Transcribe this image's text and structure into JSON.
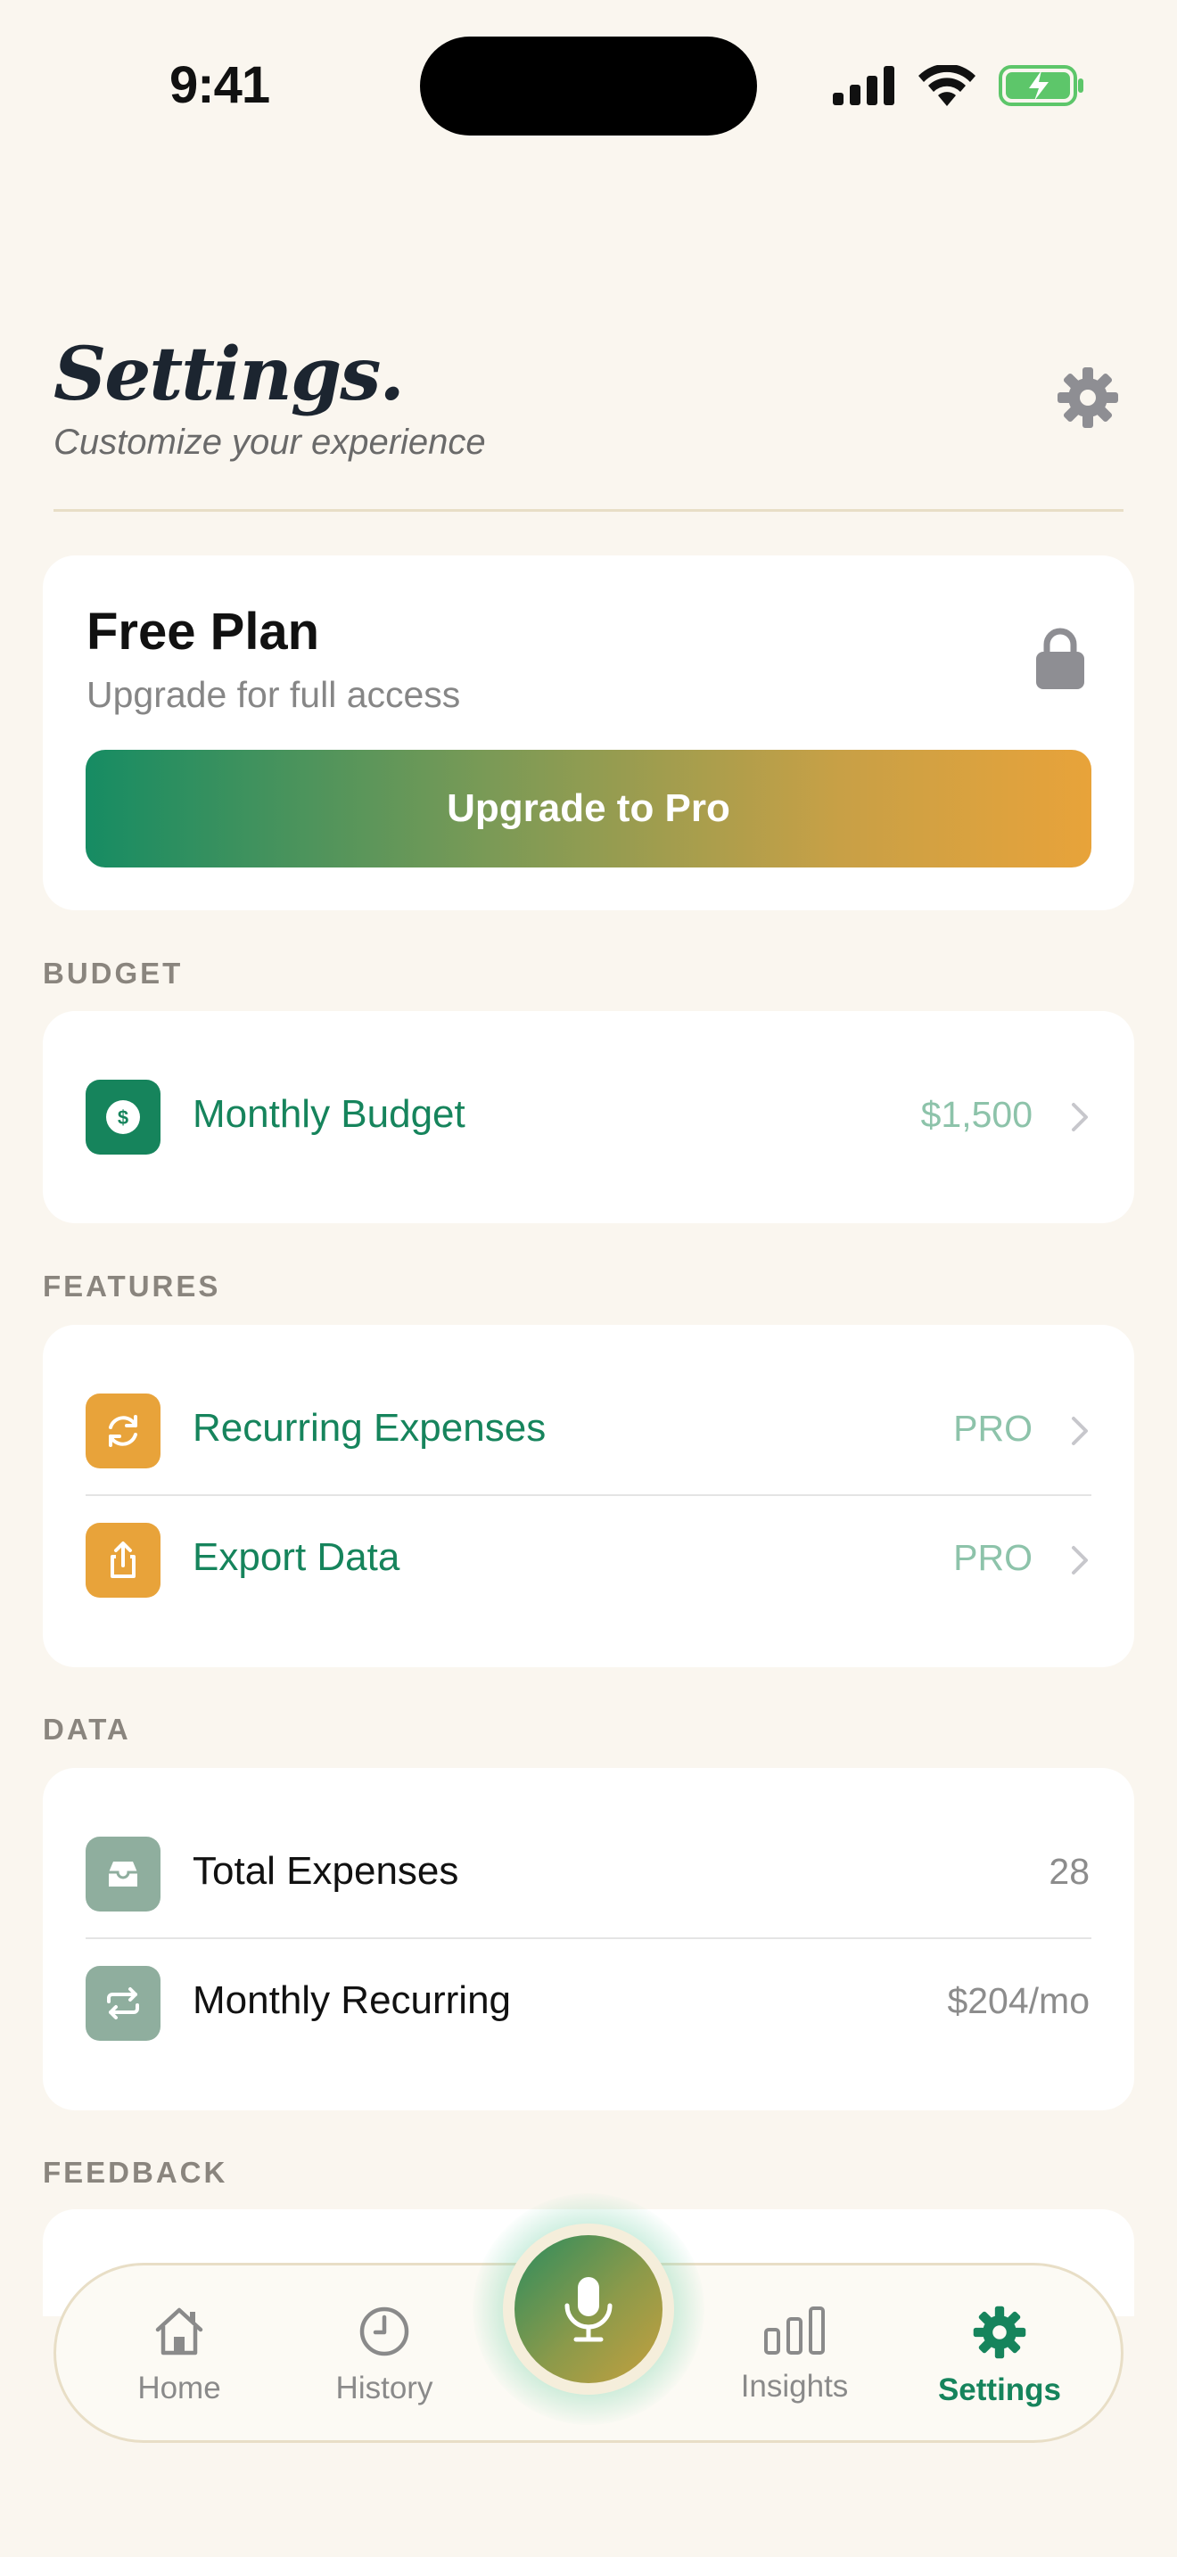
{
  "status": {
    "time": "9:41"
  },
  "header": {
    "title": "Settings.",
    "subtitle": "Customize your experience"
  },
  "plan": {
    "title": "Free Plan",
    "subtitle": "Upgrade for full access",
    "button_label": "Upgrade to Pro"
  },
  "sections": {
    "budget": {
      "label": "BUDGET",
      "items": [
        {
          "label": "Monthly Budget",
          "value": "$1,500",
          "icon": "dollar-icon"
        }
      ]
    },
    "features": {
      "label": "FEATURES",
      "items": [
        {
          "label": "Recurring Expenses",
          "value": "PRO",
          "icon": "recurring-icon"
        },
        {
          "label": "Export Data",
          "value": "PRO",
          "icon": "share-icon"
        }
      ]
    },
    "data": {
      "label": "DATA",
      "items": [
        {
          "label": "Total Expenses",
          "value": "28",
          "icon": "tray-icon"
        },
        {
          "label": "Monthly Recurring",
          "value": "$204/mo",
          "icon": "repeat-icon"
        }
      ]
    },
    "feedback": {
      "label": "FEEDBACK"
    }
  },
  "tabs": [
    {
      "label": "Home",
      "icon": "home-icon"
    },
    {
      "label": "History",
      "icon": "clock-icon"
    },
    {
      "label": "Insights",
      "icon": "bar-chart-icon"
    },
    {
      "label": "Settings",
      "icon": "gear-icon",
      "active": true
    }
  ],
  "colors": {
    "background": "#FAF6EF",
    "accent_green": "#16845C",
    "accent_orange": "#E8A33A",
    "muted_sage": "#8FAE9E"
  }
}
